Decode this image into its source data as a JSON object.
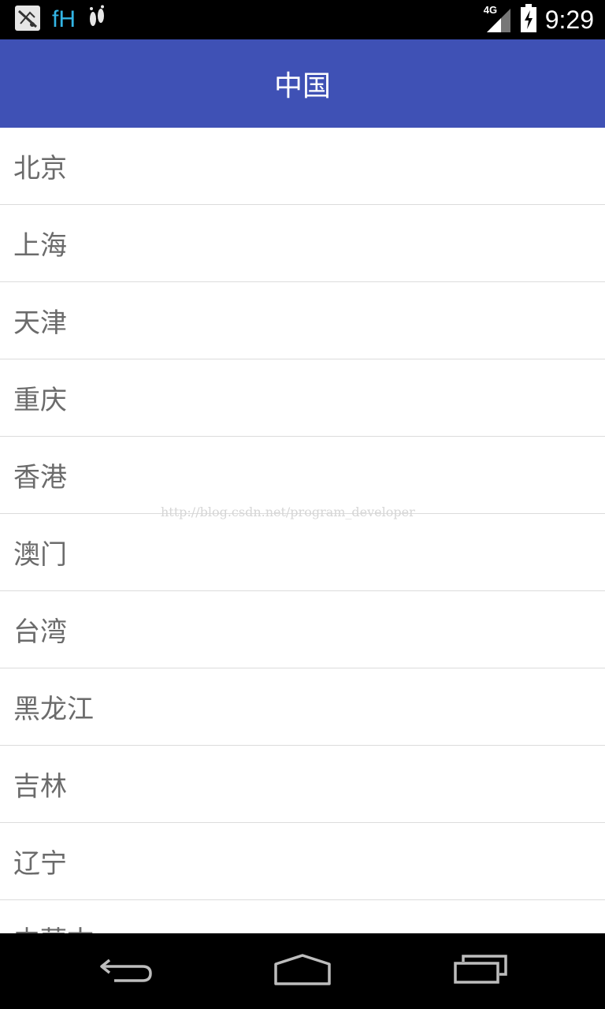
{
  "status_bar": {
    "time": "9:29",
    "network": "4G",
    "app_text": "fH",
    "icons": [
      "app-launcher-icon",
      "feet-icon",
      "signal-icon",
      "battery-charging-icon"
    ]
  },
  "app_bar": {
    "title": "中国"
  },
  "list": {
    "items": [
      {
        "label": "北京"
      },
      {
        "label": "上海"
      },
      {
        "label": "天津"
      },
      {
        "label": "重庆"
      },
      {
        "label": "香港"
      },
      {
        "label": "澳门"
      },
      {
        "label": "台湾"
      },
      {
        "label": "黑龙江"
      },
      {
        "label": "吉林"
      },
      {
        "label": "辽宁"
      },
      {
        "label": "内蒙古"
      }
    ]
  },
  "watermark": "http://blog.csdn.net/program_developer",
  "nav_bar": {
    "icons": [
      "back-icon",
      "home-icon",
      "recents-icon"
    ]
  },
  "colors": {
    "app_bar": "#3f51b5",
    "status_bar": "#000000",
    "list_text": "#6b6b6b",
    "divider": "#dcdcdc"
  }
}
